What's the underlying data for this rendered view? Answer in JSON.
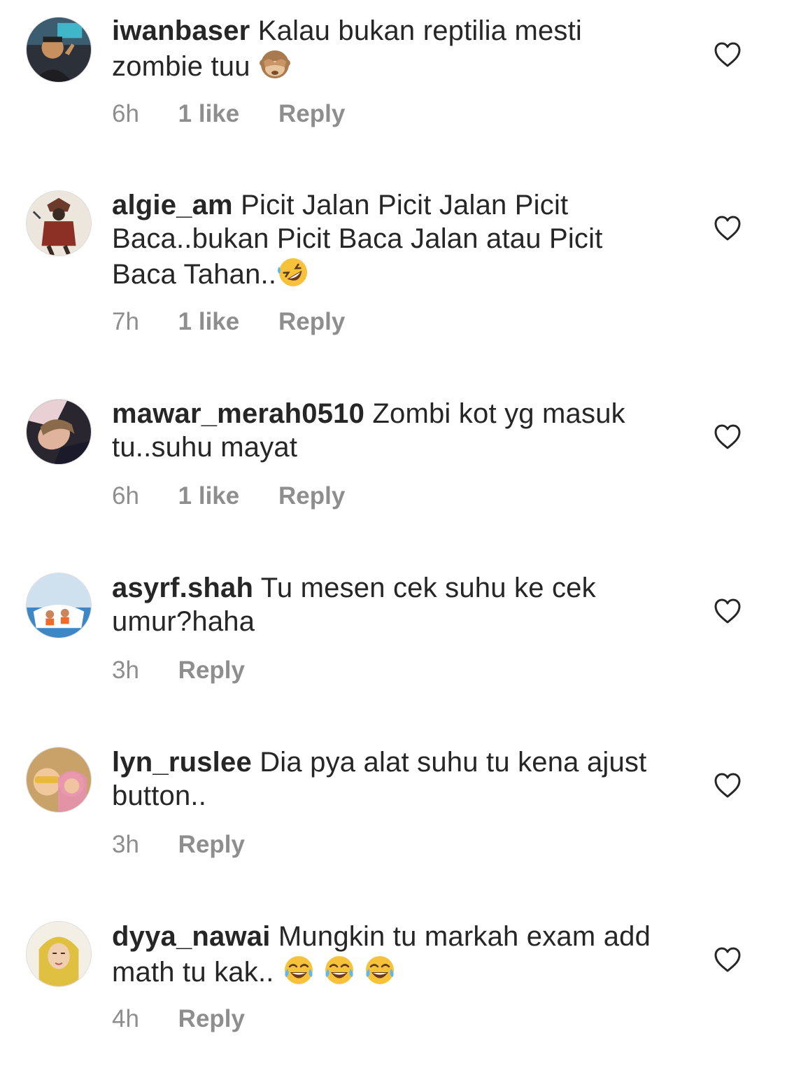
{
  "comments": [
    {
      "username": "iwanbaser",
      "text": "Kalau bukan reptilia mesti zombie tuu",
      "emojis": [
        "see-no-evil-monkey"
      ],
      "time": "6h",
      "likes": "1 like",
      "reply": "Reply",
      "avatar_color": "#3a3a44"
    },
    {
      "username": "algie_am",
      "text": "Picit Jalan Picit Jalan Picit Baca..bukan Picit Baca Jalan atau Picit Baca Tahan..",
      "emojis": [
        "rolling-on-floor-laughing"
      ],
      "time": "7h",
      "likes": "1 like",
      "reply": "Reply",
      "avatar_color": "#b9a48a"
    },
    {
      "username": "mawar_merah0510",
      "text": "Zombi kot yg masuk tu..suhu mayat",
      "emojis": [],
      "time": "6h",
      "likes": "1 like",
      "reply": "Reply",
      "avatar_color": "#5a4a55"
    },
    {
      "username": "asyrf.shah",
      "text": "Tu mesen cek suhu ke cek umur?haha",
      "emojis": [],
      "time": "3h",
      "likes": "",
      "reply": "Reply",
      "avatar_color": "#7aa4c8"
    },
    {
      "username": "lyn_ruslee",
      "text": "Dia pya alat suhu tu kena ajust button..",
      "emojis": [],
      "time": "3h",
      "likes": "",
      "reply": "Reply",
      "avatar_color": "#d9a05a"
    },
    {
      "username": "dyya_nawai",
      "text": "Mungkin tu markah exam add math tu kak..",
      "emojis": [
        "tears-of-joy",
        "tears-of-joy",
        "tears-of-joy"
      ],
      "time": "4h",
      "likes": "",
      "reply": "Reply",
      "avatar_color": "#d8b64a"
    }
  ],
  "colors": {
    "text": "#262626",
    "meta": "#8e8e8e",
    "heart_stroke": "#262626",
    "emoji_face": "#f7c23a"
  },
  "icons": {
    "like": "heart-outline-icon"
  }
}
